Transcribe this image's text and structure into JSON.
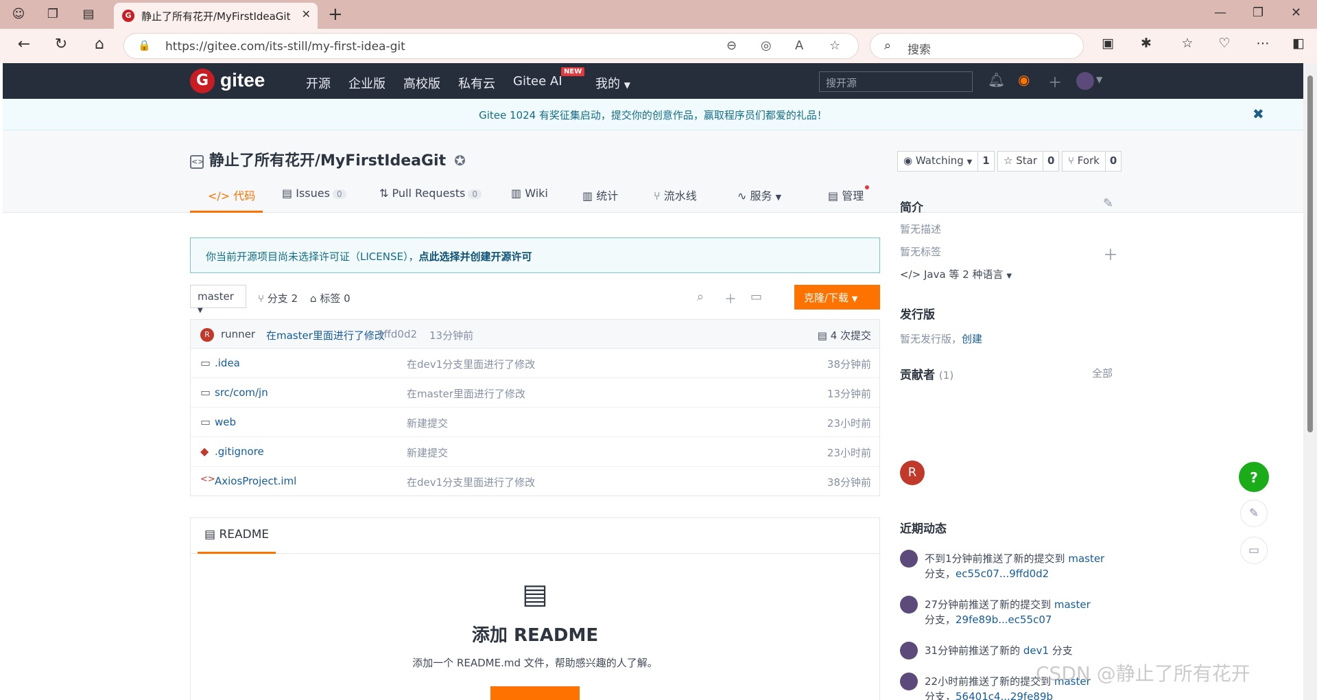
{
  "browser": {
    "tab_title": "静止了所有花开/MyFirstIdeaGit",
    "url": "https://gitee.com/its-still/my-first-idea-git",
    "search_placeholder": "搜索"
  },
  "header": {
    "logo_text": "gitee",
    "nav": [
      "开源",
      "企业版",
      "高校版",
      "私有云",
      "Gitee AI",
      "我的"
    ],
    "new_badge": "NEW",
    "search_placeholder": "搜开源"
  },
  "banner": {
    "text": "Gitee 1024 有奖征集启动，提交你的创意作品，赢取程序员们都爱的礼品！"
  },
  "project": {
    "title": "静止了所有花开/MyFirstIdeaGit",
    "watching": {
      "label": "Watching",
      "count": "1"
    },
    "star": {
      "label": "Star",
      "count": "0"
    },
    "fork": {
      "label": "Fork",
      "count": "0"
    },
    "tabs": [
      {
        "label": "代码"
      },
      {
        "label": "Issues",
        "count": "0"
      },
      {
        "label": "Pull Requests",
        "count": "0"
      },
      {
        "label": "Wiki"
      },
      {
        "label": "统计"
      },
      {
        "label": "流水线"
      },
      {
        "label": "服务"
      },
      {
        "label": "管理"
      }
    ]
  },
  "license": {
    "text": "你当前开源项目尚未选择许可证（LICENSE），",
    "link": "点此选择并创建开源许可"
  },
  "toolbar": {
    "branch": "master",
    "branches": "分支 2",
    "tags": "标签 0",
    "clone": "克隆/下载"
  },
  "commit": {
    "avatar": "R",
    "author": "runner",
    "message": "在master里面进行了修改",
    "hash": "9ffd0d2",
    "time": "13分钟前",
    "count": "4 次提交"
  },
  "files": [
    {
      "name": ".idea",
      "message": "在dev1分支里面进行了修改",
      "time": "38分钟前",
      "icon": "folder-icon"
    },
    {
      "name": "src/com/jn",
      "message": "在master里面进行了修改",
      "time": "13分钟前",
      "icon": "folder-icon"
    },
    {
      "name": "web",
      "message": "新建提交",
      "time": "23小时前",
      "icon": "folder-icon"
    },
    {
      "name": ".gitignore",
      "message": "新建提交",
      "time": "23小时前",
      "icon": "git-icon"
    },
    {
      "name": "AxiosProject.iml",
      "message": "在dev1分支里面进行了修改",
      "time": "38分钟前",
      "icon": "code-icon"
    }
  ],
  "readme": {
    "tab": "README",
    "heading": "添加 README",
    "desc": "添加一个 README.md 文件，帮助感兴趣的人了解。"
  },
  "sidebar": {
    "intro_title": "简介",
    "no_desc": "暂无描述",
    "no_tags": "暂无标签",
    "language": "Java 等 2 种语言",
    "release_title": "发行版",
    "no_release": "暂无发行版，",
    "create": "创建",
    "contrib_title": "贡献者",
    "contrib_count": "(1)",
    "contrib_all": "全部",
    "contrib_avatar": "R",
    "activity_title": "近期动态",
    "activities": [
      {
        "line1": "不到1分钟前推送了新的提交到 ",
        "branch": "master",
        "line2": "分支，",
        "link": "ec55c07...9ffd0d2"
      },
      {
        "line1": "27分钟前推送了新的提交到 ",
        "branch": "master",
        "line2": "分支，",
        "link": "29fe89b...ec55c07"
      },
      {
        "line1": "31分钟前推送了新的 ",
        "branch": "dev1",
        "line2": " 分支",
        "link": ""
      },
      {
        "line1": "22小时前推送了新的提交到 ",
        "branch": "master",
        "line2": "分支，",
        "link": "56401c4...29fe89b"
      }
    ]
  },
  "watermark": "CSDN @静止了所有花开",
  "colors": {
    "accent": "#fe7300",
    "header_bg": "#272e3b",
    "brand": "#c71d23"
  }
}
